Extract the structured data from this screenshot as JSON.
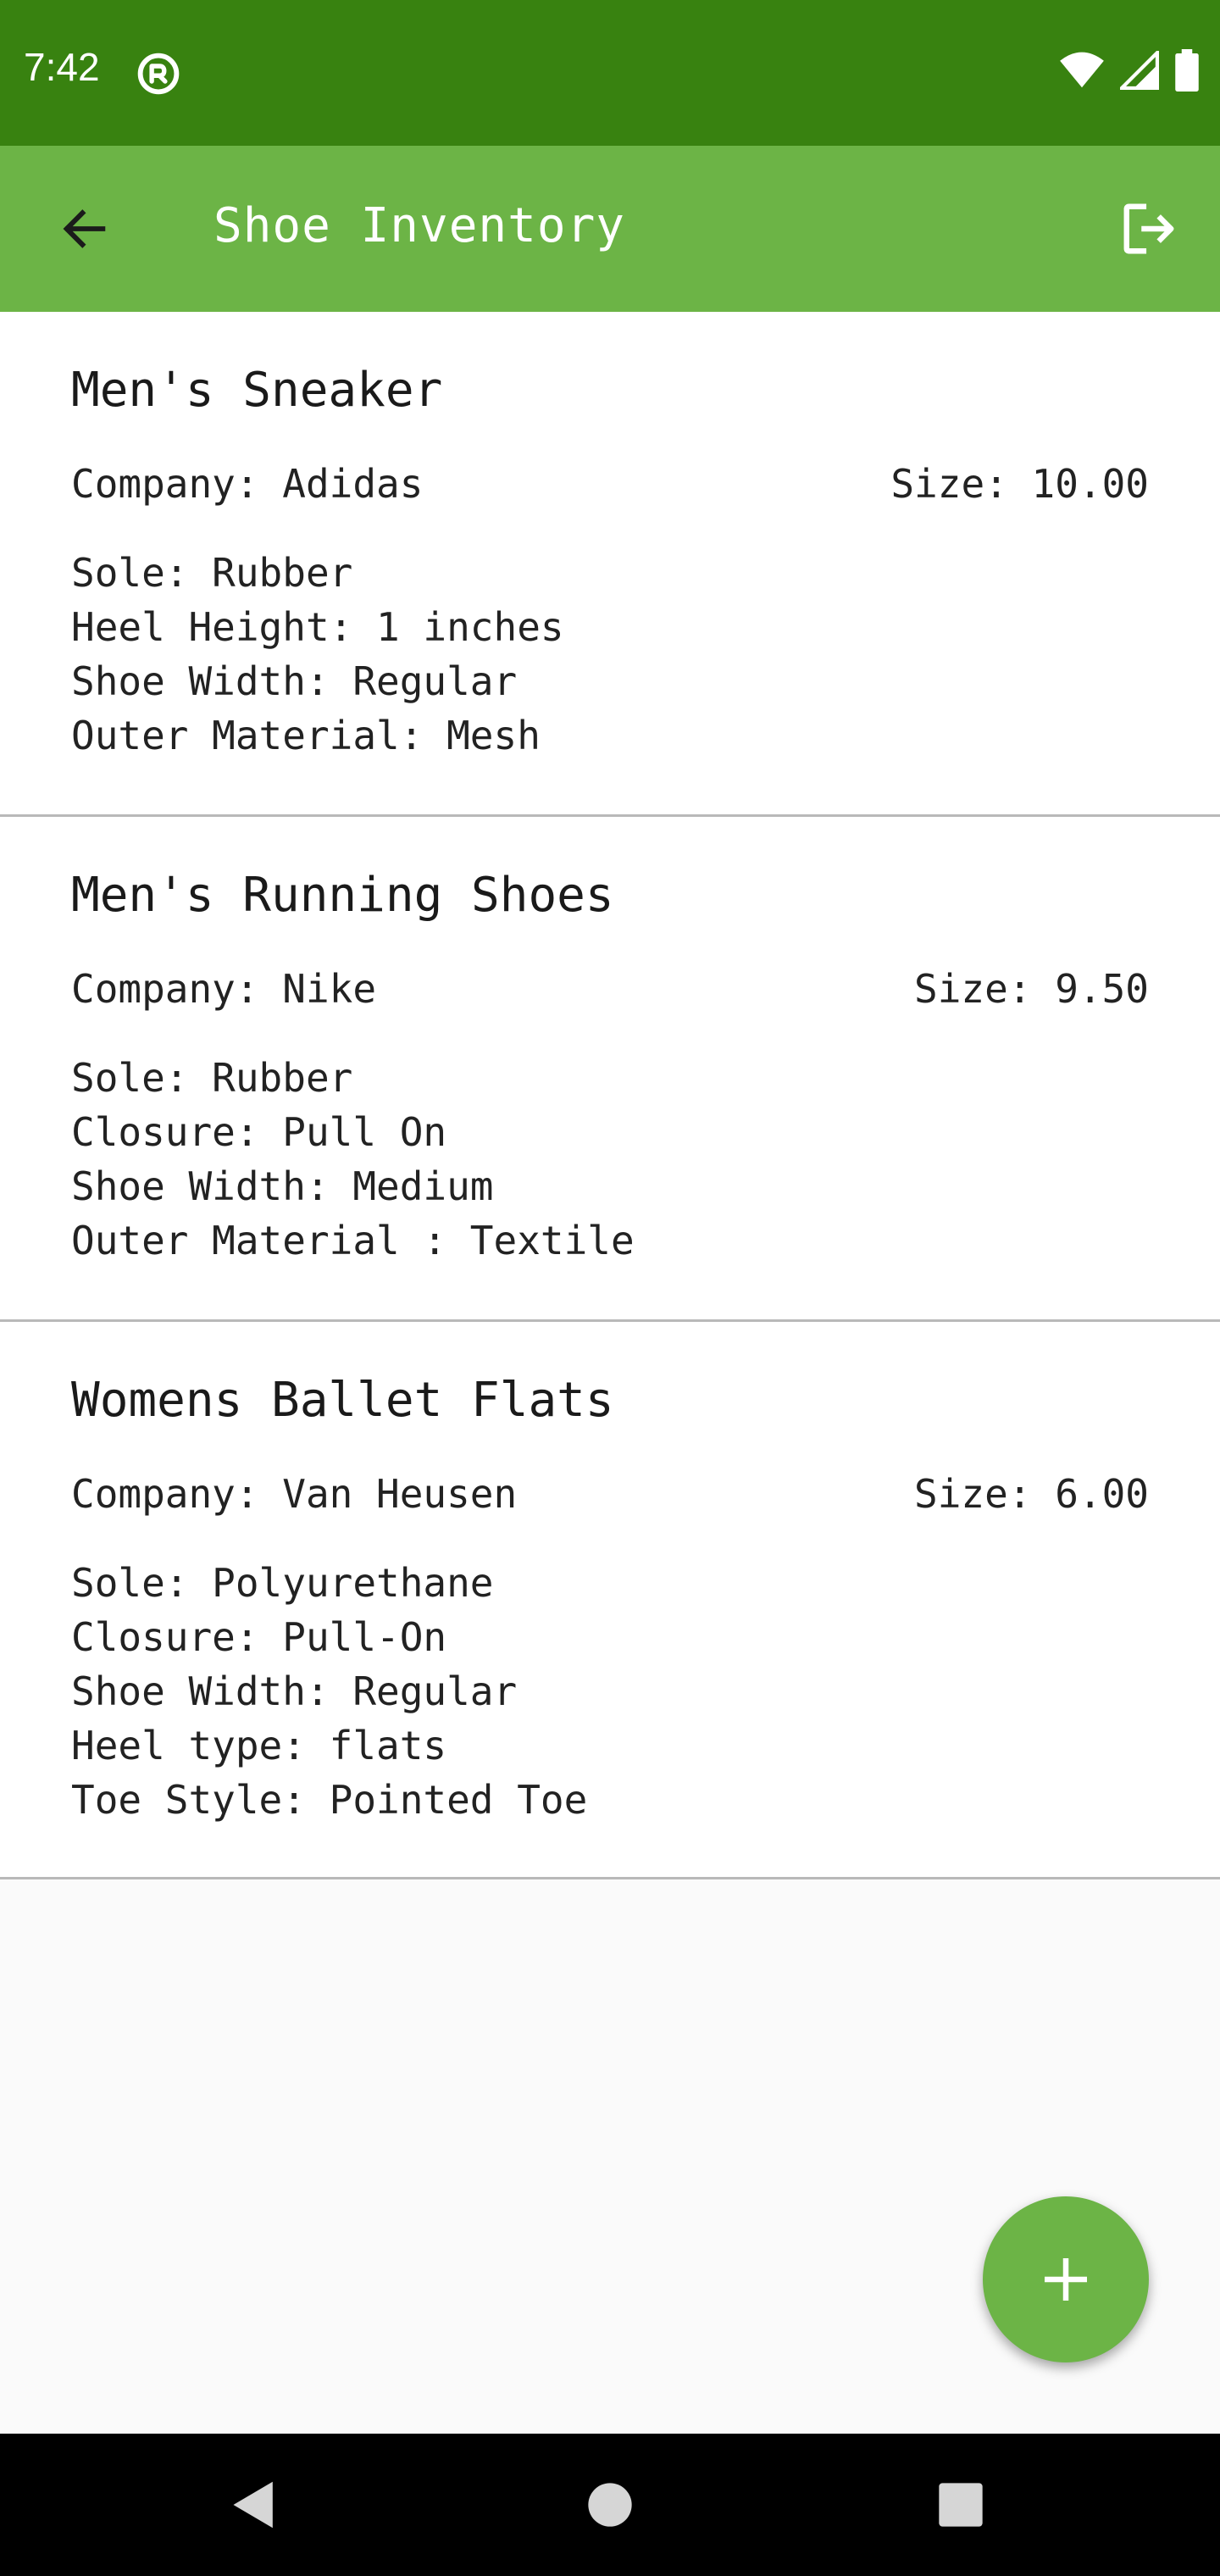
{
  "status_bar": {
    "time": "7:42",
    "icons": [
      "app-notification-icon",
      "wifi-icon",
      "signal-icon",
      "battery-icon"
    ]
  },
  "app_bar": {
    "title": "Shoe Inventory",
    "back_icon": "arrow-back-icon",
    "logout_icon": "logout-icon"
  },
  "shoes": [
    {
      "name": "Men's Sneaker",
      "company": "Company: Adidas",
      "size": "Size: 10.00",
      "details": [
        "Sole: Rubber",
        "Heel Height: 1 inches",
        "Shoe Width: Regular",
        "Outer Material: Mesh"
      ]
    },
    {
      "name": "Men's Running Shoes",
      "company": "Company: Nike",
      "size": "Size: 9.50",
      "details": [
        "Sole: Rubber",
        "Closure: Pull On",
        "Shoe Width: Medium",
        "Outer Material : Textile"
      ]
    },
    {
      "name": "Womens Ballet Flats",
      "company": "Company: Van Heusen",
      "size": "Size: 6.00",
      "details": [
        "Sole: Polyurethane",
        "Closure: Pull-On",
        "Shoe Width: Regular",
        "Heel type: flats",
        "Toe Style: Pointed Toe"
      ]
    }
  ],
  "fab": {
    "icon": "plus-icon"
  },
  "colors": {
    "status_bar": "#388210",
    "app_bar": "#6cb446",
    "fab": "#6cb446"
  }
}
